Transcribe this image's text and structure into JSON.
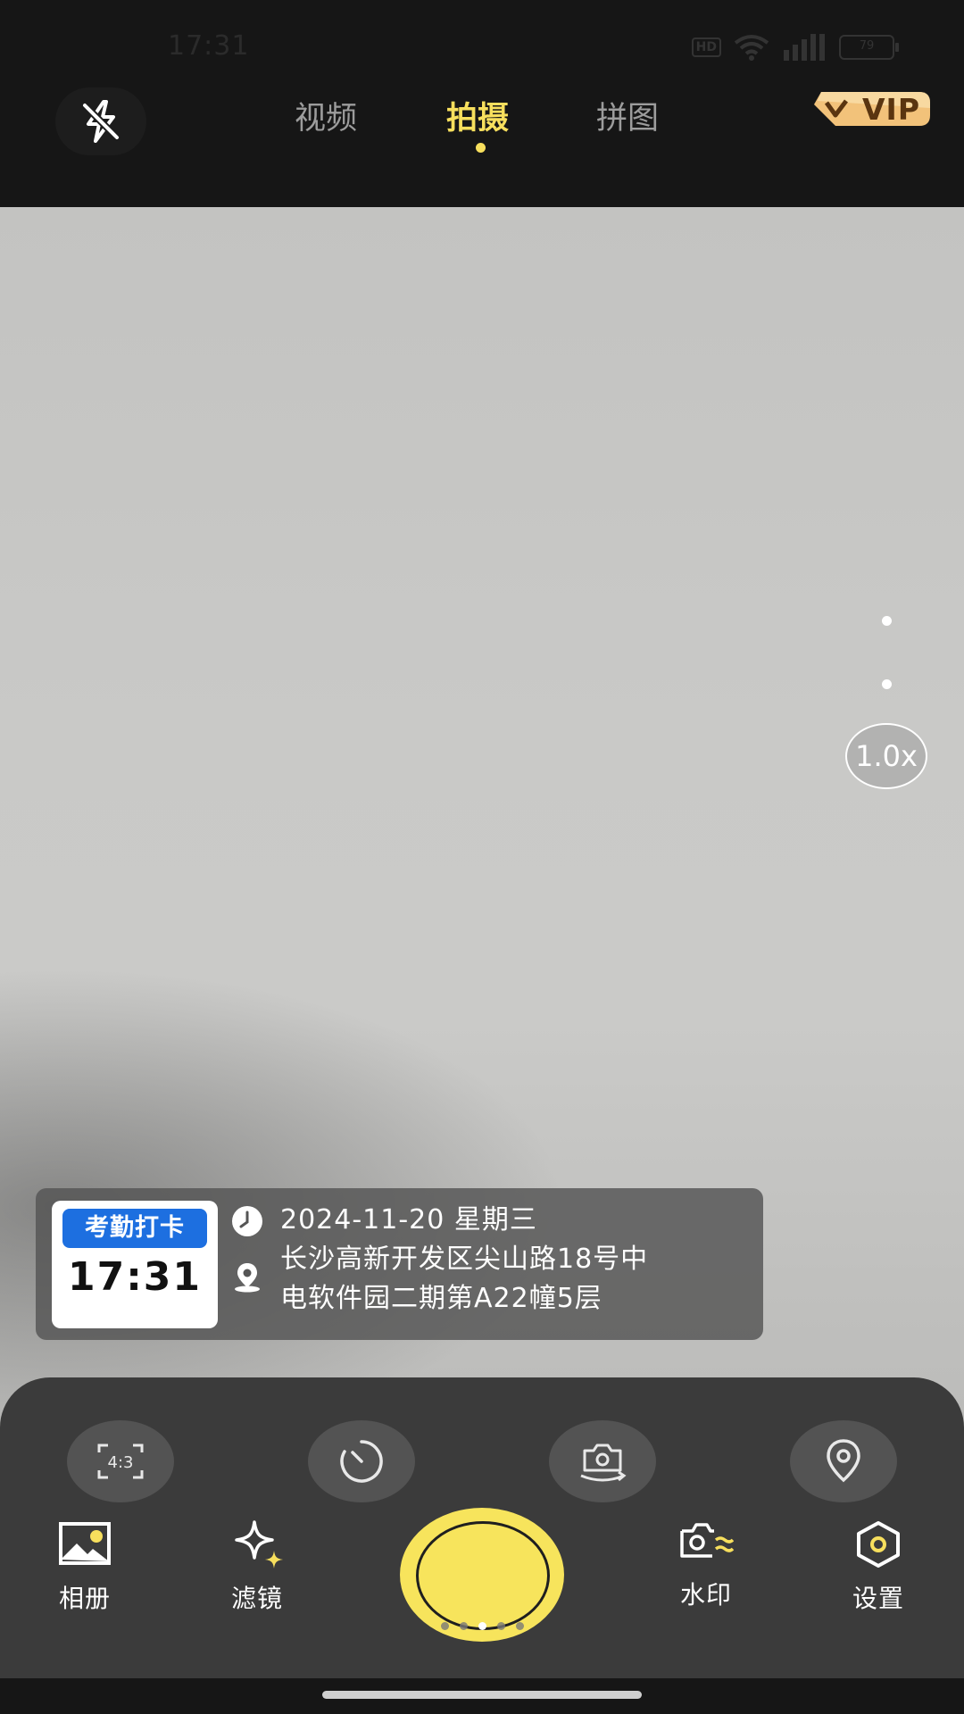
{
  "status_bar": {
    "time": "17:31",
    "hd": "HD",
    "battery": "79"
  },
  "top_bar": {
    "tabs": [
      {
        "label": "视频",
        "active": false
      },
      {
        "label": "拍摄",
        "active": true
      },
      {
        "label": "拼图",
        "active": false
      }
    ],
    "vip_label": "VIP",
    "icons": {
      "flash": "flash-off-icon",
      "vip": "vip-crown-icon"
    }
  },
  "preview": {
    "zoom_label": "1.0x"
  },
  "watermark": {
    "stamp_title": "考勤打卡",
    "stamp_time": "17:31",
    "date_line": "2024-11-20 星期三",
    "address_line_1": "长沙高新开发区尖山路18号中",
    "address_line_2": "电软件园二期第A22幢5层"
  },
  "toolbar": {
    "buttons": [
      {
        "name": "aspect-ratio",
        "label": "4:3"
      },
      {
        "name": "timer"
      },
      {
        "name": "switch-camera"
      },
      {
        "name": "location"
      }
    ]
  },
  "bottom_nav": {
    "album": "相册",
    "filter": "滤镜",
    "watermark": "水印",
    "settings": "设置"
  },
  "colors": {
    "accent": "#f7df5d",
    "shutter": "#f7e45c",
    "stamp_blue": "#1d6fe0"
  }
}
